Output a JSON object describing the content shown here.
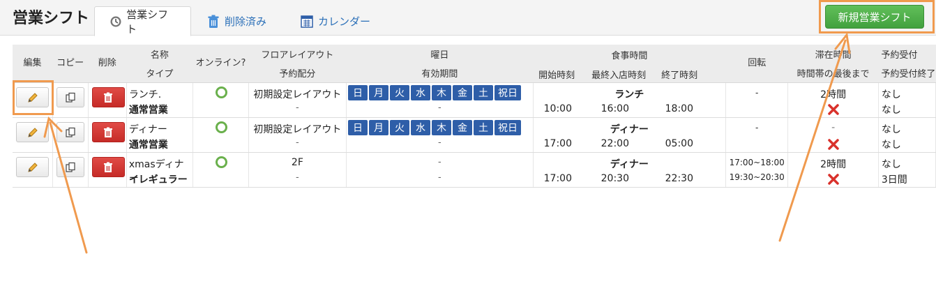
{
  "header": {
    "title": "営業シフト",
    "tabs": [
      {
        "label": "営業シフト",
        "icon": "clock-icon",
        "active": true
      },
      {
        "label": "削除済み",
        "icon": "trash-icon",
        "active": false
      },
      {
        "label": "カレンダー",
        "icon": "calendar-icon",
        "active": false
      }
    ],
    "new_button": "新規営業シフト"
  },
  "table": {
    "headers": {
      "edit": "編集",
      "copy": "コピー",
      "delete": "削除",
      "name": "名称",
      "type": "タイプ",
      "online": "オンライン?",
      "floor": "フロアレイアウト",
      "allocation": "予約配分",
      "weekday": "曜日",
      "period": "有効期間",
      "meal": "食事時間",
      "start": "開始時刻",
      "last_entry": "最終入店時刻",
      "end": "終了時刻",
      "rotation": "回転",
      "stay": "滞在時間",
      "stay_sub": "時間帯の最後まで",
      "accept": "予約受付",
      "accept_end": "予約受付終了"
    },
    "days": [
      "日",
      "月",
      "火",
      "水",
      "木",
      "金",
      "土",
      "祝日"
    ],
    "rows": [
      {
        "name": "ランチ.",
        "type": "通常営業",
        "floor": "初期設定レイアウト",
        "alloc": "-",
        "period": "-",
        "meal": "ランチ",
        "start": "10:00",
        "last": "16:00",
        "end": "18:00",
        "rot1": "-",
        "rot2": "",
        "stay": "2時間",
        "acc1": "なし",
        "acc2": "なし"
      },
      {
        "name": "ディナー",
        "type": "通常営業",
        "floor": "初期設定レイアウト",
        "alloc": "-",
        "period": "-",
        "meal": "ディナー",
        "start": "17:00",
        "last": "22:00",
        "end": "05:00",
        "rot1": "-",
        "rot2": "",
        "stay": "-",
        "acc1": "なし",
        "acc2": "なし"
      },
      {
        "name": "xmasディナー",
        "type": "イレギュラー",
        "floor": "2F",
        "alloc": "-",
        "weekday": "-",
        "period": "-",
        "meal": "ディナー",
        "start": "17:00",
        "last": "20:30",
        "end": "22:30",
        "rot1": "17:00~18:00",
        "rot2": "19:30~20:30",
        "stay": "2時間",
        "acc1": "なし",
        "acc2": "3日間"
      }
    ]
  },
  "colors": {
    "accent_orange": "#f09a4e",
    "green_button": "#4caf50",
    "day_blue": "#2e5ea8",
    "delete_red": "#d23a35"
  }
}
